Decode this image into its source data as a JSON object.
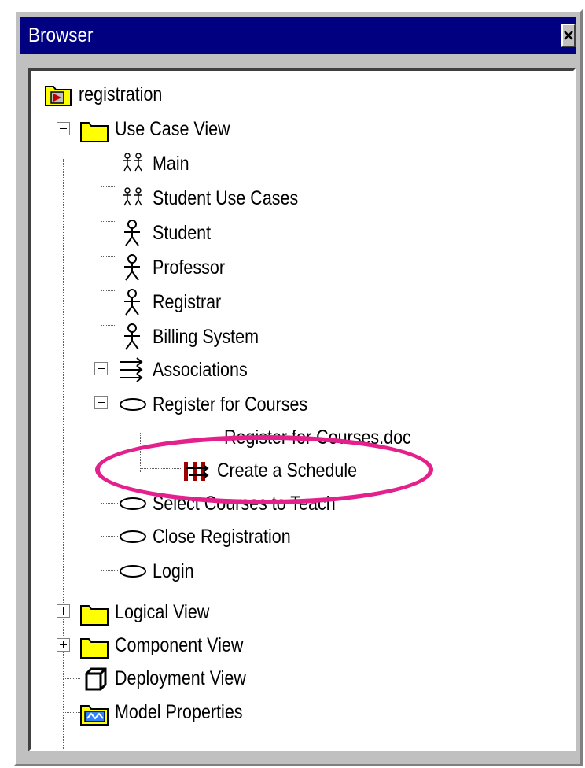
{
  "window": {
    "title": "Browser",
    "close_label": "×"
  },
  "tree": {
    "root": "registration",
    "use_case_view": {
      "label": "Use Case View",
      "items": {
        "main": "Main",
        "student_use_cases": "Student Use Cases",
        "student": "Student",
        "professor": "Professor",
        "registrar": "Registrar",
        "billing_system": "Billing System",
        "associations": "Associations",
        "register_for_courses": "Register for Courses",
        "register_doc": "Register for Courses.doc",
        "create_schedule": "Create a Schedule",
        "select_courses": "Select Courses to Teach",
        "close_registration": "Close Registration",
        "login": "Login"
      }
    },
    "logical_view": "Logical View",
    "component_view": "Component View",
    "deployment_view": "Deployment View",
    "model_properties": "Model Properties"
  },
  "colors": {
    "titlebar": "#000080",
    "highlight": "#e3208b",
    "folder": "#ffff00"
  }
}
